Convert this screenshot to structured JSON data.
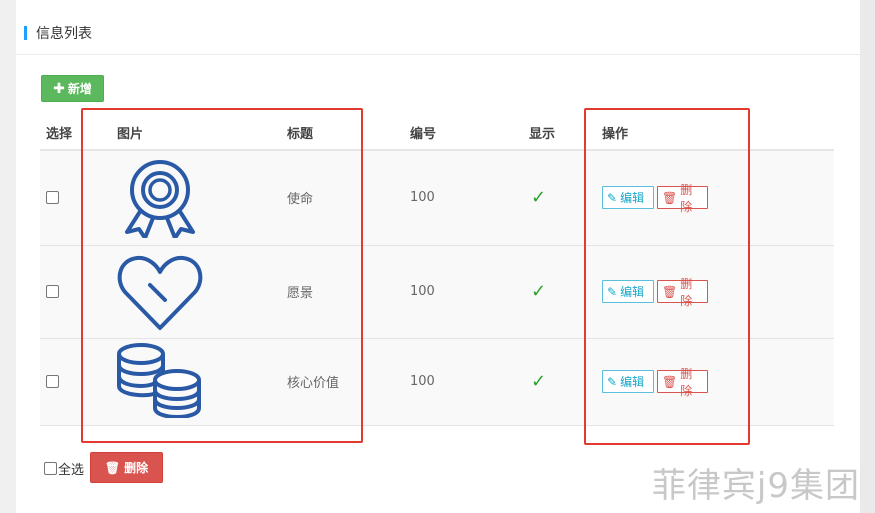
{
  "header": {
    "title": "信息列表"
  },
  "toolbar": {
    "add_label": "新增",
    "add_icon": "plus-icon"
  },
  "table": {
    "columns": {
      "select": "选择",
      "image": "图片",
      "title": "标题",
      "number": "编号",
      "show": "显示",
      "ops": "操作"
    },
    "rows": [
      {
        "image_icon": "award-ribbon-icon",
        "title": "使命",
        "number": "100",
        "show": "✓",
        "edit_label": "编辑",
        "delete_label": "删除"
      },
      {
        "image_icon": "heart-icon",
        "title": "愿景",
        "number": "100",
        "show": "✓",
        "edit_label": "编辑",
        "delete_label": "删除"
      },
      {
        "image_icon": "coins-stack-icon",
        "title": "核心价值",
        "number": "100",
        "show": "✓",
        "edit_label": "编辑",
        "delete_label": "删除"
      }
    ]
  },
  "footer": {
    "select_all_label": "全选",
    "bulk_delete_label": "删除"
  },
  "watermark": "菲律宾j9集团",
  "colors": {
    "accent": "#1e9fff",
    "add_green": "#5cb85c",
    "danger_red": "#d9534f",
    "info_blue": "#5bc0de",
    "icon_blue": "#2a5aa6",
    "highlight_red": "#e23a2e"
  }
}
